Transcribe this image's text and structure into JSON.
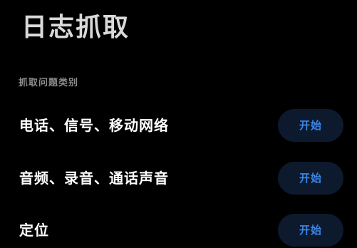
{
  "page": {
    "title": "日志抓取"
  },
  "section": {
    "label": "抓取问题类别"
  },
  "categories": [
    {
      "label": "电话、信号、移动网络",
      "button_label": "开始"
    },
    {
      "label": "音频、录音、通话声音",
      "button_label": "开始"
    },
    {
      "label": "定位",
      "button_label": "开始"
    }
  ],
  "colors": {
    "background": "#000000",
    "title": "#d9d9d9",
    "section_label": "#8c8c8c",
    "button_bg": "#0d1a2e",
    "button_text": "#3b87e8"
  }
}
